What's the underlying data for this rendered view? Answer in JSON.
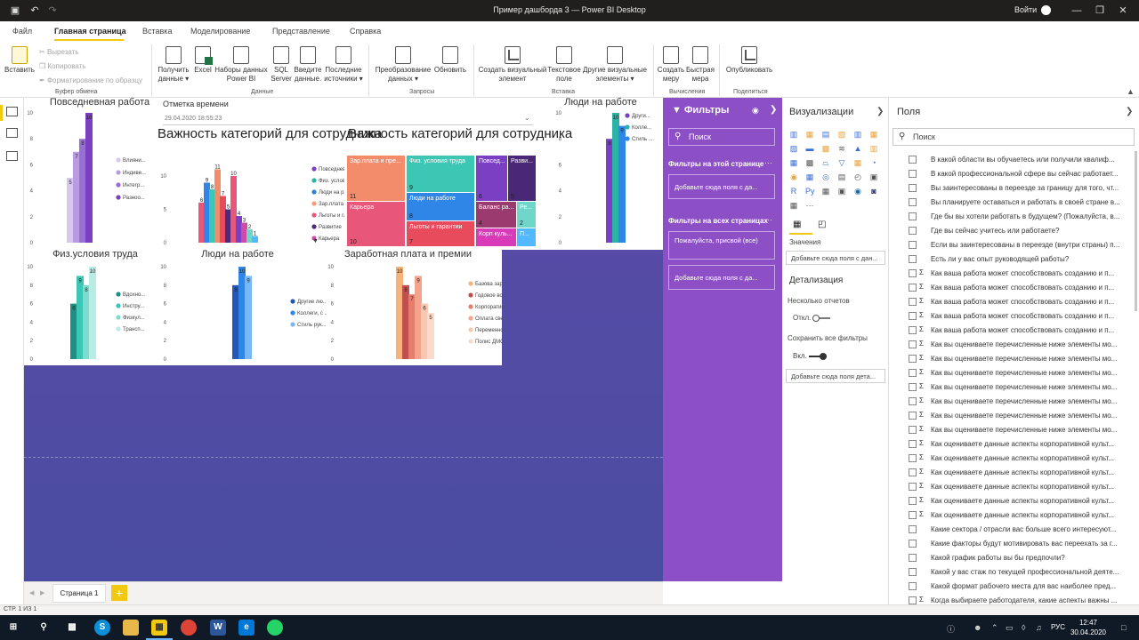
{
  "window": {
    "title": "Пример дашборда 3 — Power BI Desktop",
    "sign_in": "Войти"
  },
  "menu": {
    "tabs": [
      "Файл",
      "Главная страница",
      "Вставка",
      "Моделирование",
      "Представление",
      "Справка"
    ],
    "active": "Главная страница"
  },
  "ribbon": {
    "paste": "Вставить",
    "cut": "Вырезать",
    "copy": "Копировать",
    "format_painter": "Форматирование по образцу",
    "clipboard_group": "Буфер обмена",
    "get_data": "Получить данные",
    "excel": "Excel",
    "power_bi_datasets": "Наборы данных Power BI",
    "sql_server": "SQL Server",
    "enter_data": "Введите данные.",
    "recent_sources": "Последние источники",
    "data_group": "Данные",
    "transform_data": "Преобразование данных",
    "refresh": "Обновить",
    "queries_group": "Запросы",
    "new_visual": "Создать визуальный элемент",
    "text_box": "Текстовое поле",
    "more_visuals": "Другие визуальные элементы",
    "insert_group": "Вставка",
    "new_measure": "Создать меру",
    "quick_measure": "Быстрая мера",
    "calculations_group": "Вычисления",
    "publish": "Опубликовать",
    "share_group": "Поделиться"
  },
  "visuals": {
    "daily_work": {
      "title": "Повседневная работа",
      "yticks": [
        "10",
        "8",
        "6",
        "4",
        "2",
        "0"
      ],
      "legend": [
        "Влияни...",
        "Индиве...",
        "Интегр...",
        "Разноо..."
      ],
      "colors": [
        "#d7c8ef",
        "#b89be0",
        "#9a6fd2",
        "#7a3fc3"
      ]
    },
    "time_slicer": {
      "title": "Отметка времени",
      "value": "29.04.2020 18:55:23"
    },
    "importance_bar": {
      "title": "Важность категорий для сотрудника",
      "yticks": [
        "10",
        "5",
        "0"
      ],
      "legend": [
        "Повседневная...",
        "Физ. условия т...",
        "Люди на рабо...",
        "Зар.плата и п...",
        "Льготы и гара...",
        "Развитие",
        "Карьера"
      ],
      "legend_colors": [
        "#7b3fc4",
        "#2ab3a6",
        "#2f7fe0",
        "#f3a07a",
        "#e8577a",
        "#4b2a7a",
        "#d04aa8"
      ]
    },
    "importance_treemap": {
      "title": "Важность категорий для сотрудника",
      "cells": [
        {
          "label": "Зар.плата и пре...",
          "value": "11",
          "color": "#f28c6b"
        },
        {
          "label": "Карьера",
          "value": "10",
          "color": "#e8577a"
        },
        {
          "label": "Физ. условия труда",
          "value": "9",
          "color": "#3cc7b4"
        },
        {
          "label": "Люди на работе",
          "value": "8",
          "color": "#2f86e6"
        },
        {
          "label": "Льготы и гарантии",
          "value": "7",
          "color": "#e84c5c"
        },
        {
          "label": "Повсед...",
          "value": "6",
          "color": "#7a3fc3"
        },
        {
          "label": "Разви...",
          "value": "5",
          "color": "#4b2777"
        },
        {
          "label": "Баланс ра...",
          "value": "4",
          "color": "#9a3a6e"
        },
        {
          "label": "Ре...",
          "value": "2",
          "color": "#6fd6c9"
        },
        {
          "label": "Корп куль...",
          "value": "",
          "color": "#d83ab8"
        },
        {
          "label": "П...",
          "value": "",
          "color": "#52b8ff"
        }
      ]
    },
    "people_top": {
      "title": "Люди на работе",
      "yticks": [
        "10",
        "8",
        "6",
        "4",
        "2",
        "0"
      ],
      "legend": [
        "Други...",
        "Колле...",
        "Стиль ..."
      ],
      "colors": [
        "#7a3fc3",
        "#2ab3a6",
        "#2f86e6"
      ]
    },
    "phys_conditions": {
      "title": "Физ.условия труда",
      "yticks": [
        "10",
        "8",
        "6",
        "4",
        "2",
        "0"
      ],
      "legend": [
        "Вдохно...",
        "Инстру...",
        "Физкул...",
        "Трансп..."
      ],
      "colors": [
        "#1f8f84",
        "#3cc7b4",
        "#7ddcd0",
        "#b8ece4"
      ]
    },
    "people_bottom": {
      "title": "Люди на работе",
      "yticks": [
        "10",
        "8",
        "6",
        "4",
        "2",
        "0"
      ],
      "legend": [
        "Другие лю...",
        "Коллеги, с ...",
        "Стиль рук..."
      ],
      "colors": [
        "#2557b8",
        "#2f86e6",
        "#7ab7f5"
      ]
    },
    "salary": {
      "title": "Заработная плата и премии",
      "yticks": [
        "10",
        "8",
        "6",
        "4",
        "2",
        "0"
      ],
      "legend": [
        "Базова зарабо...",
        "Годовое возн...",
        "Корпоративна...",
        "Оплата сверху...",
        "Переменное в...",
        "Полис ДМС"
      ],
      "colors": [
        "#f6b37a",
        "#c0504d",
        "#e77d6b",
        "#f4a48c",
        "#f8c7b2",
        "#fbd9cb"
      ]
    }
  },
  "filters": {
    "title": "Фильтры",
    "search": "Поиск",
    "on_page": "Фильтры на этой странице",
    "add_field_page": "Добавьте сюда поля с да...",
    "on_all_pages": "Фильтры на всех страницах",
    "card_text": "Пожалуйста, присвой (все)",
    "add_field_all": "Добавьте сюда поля с да..."
  },
  "visualizations": {
    "title": "Визуализации",
    "values_label": "Значения",
    "values_drop": "Добавьте сюда поля с дан...",
    "drillthrough": "Детализация",
    "cross_report": "Несколько отчетов",
    "cross_report_state": "Откл.",
    "keep_filters": "Сохранить все фильтры",
    "keep_filters_state": "Вкл.",
    "drill_drop": "Добавьте сюда поля дета..."
  },
  "fields": {
    "title": "Поля",
    "search": "Поиск",
    "items": [
      {
        "sigma": false,
        "name": "В какой области вы обучаетесь или получили квалиф..."
      },
      {
        "sigma": false,
        "name": "В какой профессиональной сфере вы сейчас работает..."
      },
      {
        "sigma": false,
        "name": "Вы заинтересованы в переезде за границу для того, чт..."
      },
      {
        "sigma": false,
        "name": "Вы планируете оставаться и работать в своей стране в..."
      },
      {
        "sigma": false,
        "name": "Где бы вы хотели работать в будущем? (Пожалуйста, в..."
      },
      {
        "sigma": false,
        "name": "Где вы сейчас учитесь или работаете?"
      },
      {
        "sigma": false,
        "name": "Если вы заинтересованы в переезде (внутри страны) п..."
      },
      {
        "sigma": false,
        "name": "Есть ли у вас опыт руководящей работы?"
      },
      {
        "sigma": true,
        "name": "Как ваша работа может способствовать созданию и п..."
      },
      {
        "sigma": true,
        "name": "Как ваша работа может способствовать созданию и п..."
      },
      {
        "sigma": true,
        "name": "Как ваша работа может способствовать созданию и п..."
      },
      {
        "sigma": true,
        "name": "Как ваша работа может способствовать созданию и п..."
      },
      {
        "sigma": true,
        "name": "Как ваша работа может способствовать созданию и п..."
      },
      {
        "sigma": true,
        "name": "Как вы оцениваете перечисленные ниже элементы мо..."
      },
      {
        "sigma": true,
        "name": "Как вы оцениваете перечисленные ниже элементы мо..."
      },
      {
        "sigma": true,
        "name": "Как вы оцениваете перечисленные ниже элементы мо..."
      },
      {
        "sigma": true,
        "name": "Как вы оцениваете перечисленные ниже элементы мо..."
      },
      {
        "sigma": true,
        "name": "Как вы оцениваете перечисленные ниже элементы мо..."
      },
      {
        "sigma": true,
        "name": "Как вы оцениваете перечисленные ниже элементы мо..."
      },
      {
        "sigma": true,
        "name": "Как вы оцениваете перечисленные ниже элементы мо..."
      },
      {
        "sigma": true,
        "name": "Как оцениваете данные аспекты корпоративной культ..."
      },
      {
        "sigma": true,
        "name": "Как оцениваете данные аспекты корпоративной культ..."
      },
      {
        "sigma": true,
        "name": "Как оцениваете данные аспекты корпоративной культ..."
      },
      {
        "sigma": true,
        "name": "Как оцениваете данные аспекты корпоративной культ..."
      },
      {
        "sigma": true,
        "name": "Как оцениваете данные аспекты корпоративной культ..."
      },
      {
        "sigma": true,
        "name": "Как оцениваете данные аспекты корпоративной культ..."
      },
      {
        "sigma": false,
        "name": "Какие сектора / отрасли вас больше всего интересуют..."
      },
      {
        "sigma": false,
        "name": "Какие факторы будут мотивировать вас переехать за г..."
      },
      {
        "sigma": false,
        "name": "Какой график работы вы бы предпочли?"
      },
      {
        "sigma": false,
        "name": "Какой у вас стаж по текущей профессиональной деяте..."
      },
      {
        "sigma": false,
        "name": "Какой формат рабочего места для вас наиболее пред..."
      },
      {
        "sigma": true,
        "name": "Когда выбираете работодателя, какие аспекты важны ..."
      }
    ]
  },
  "pages": {
    "current": "Страница 1",
    "add": "+",
    "status": "СТР. 1 ИЗ 1"
  },
  "taskbar": {
    "time": "12:47",
    "date": "30.04.2020",
    "lang": "РУС"
  },
  "chart_data": [
    {
      "type": "bar",
      "title": "Повседневная работа",
      "ylim": [
        0,
        10
      ],
      "series": [
        {
          "name": "Влияни...",
          "values": [
            5
          ]
        },
        {
          "name": "Индиве...",
          "values": [
            7
          ]
        },
        {
          "name": "Интегр...",
          "values": [
            8
          ]
        },
        {
          "name": "Разноо...",
          "values": [
            10
          ]
        }
      ]
    },
    {
      "type": "bar",
      "title": "Важность категорий для сотрудника",
      "ylim": [
        0,
        12
      ],
      "series": [
        {
          "values": [
            6,
            9,
            8,
            11,
            7,
            5,
            10,
            4,
            3,
            2,
            1
          ]
        }
      ],
      "colors": [
        "#e8577a",
        "#2f86e6",
        "#3cc7b4",
        "#f28c6b",
        "#e84c5c",
        "#4b2a7a",
        "#e8577a",
        "#7a3fc3",
        "#d04aa8",
        "#6fd6c9",
        "#52b8ff"
      ]
    },
    {
      "type": "bar",
      "title": "Люди на работе",
      "ylim": [
        0,
        10
      ],
      "series": [
        {
          "name": "Други...",
          "values": [
            8
          ]
        },
        {
          "name": "Колле...",
          "values": [
            10
          ]
        },
        {
          "name": "Стиль ...",
          "values": [
            9
          ]
        }
      ]
    },
    {
      "type": "bar",
      "title": "Физ.условия труда",
      "ylim": [
        0,
        10
      ],
      "series": [
        {
          "name": "Вдохно...",
          "values": [
            6
          ]
        },
        {
          "name": "Инстру...",
          "values": [
            9
          ]
        },
        {
          "name": "Физкул...",
          "values": [
            8
          ]
        },
        {
          "name": "Трансп...",
          "values": [
            10
          ]
        }
      ]
    },
    {
      "type": "bar",
      "title": "Люди на работе",
      "ylim": [
        0,
        10
      ],
      "series": [
        {
          "name": "Другие лю...",
          "values": [
            8
          ]
        },
        {
          "name": "Коллеги, с ...",
          "values": [
            10
          ]
        },
        {
          "name": "Стиль рук...",
          "values": [
            9
          ]
        }
      ]
    },
    {
      "type": "bar",
      "title": "Заработная плата и премии",
      "ylim": [
        0,
        10
      ],
      "series": [
        {
          "name": "Базова зарабо...",
          "values": [
            10
          ]
        },
        {
          "name": "Годовое возн...",
          "values": [
            8
          ]
        },
        {
          "name": "Корпоративна...",
          "values": [
            7
          ]
        },
        {
          "name": "Оплата сверху...",
          "values": [
            9
          ]
        },
        {
          "name": "Переменное в...",
          "values": [
            6
          ]
        },
        {
          "name": "Полис ДМС",
          "values": [
            5
          ]
        }
      ]
    }
  ]
}
